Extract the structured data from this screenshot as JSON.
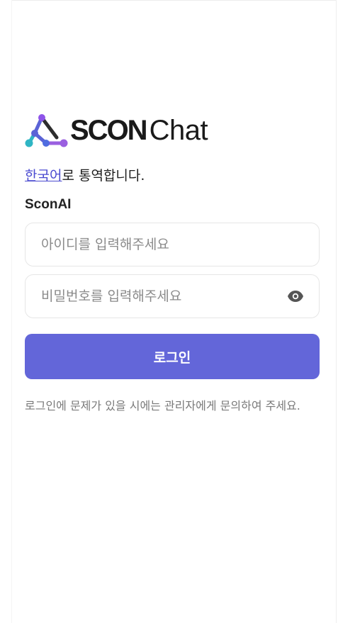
{
  "logo": {
    "bold_text": "SCON",
    "light_text": "Chat",
    "mark_icon": "scon-network-logo-icon"
  },
  "translate": {
    "language_link": "한국어",
    "suffix": "로 통역합니다."
  },
  "organization": "SconAI",
  "form": {
    "id_placeholder": "아이디를 입력해주세요",
    "password_placeholder": "비밀번호를 입력해주세요",
    "password_toggle_icon": "eye-icon",
    "login_label": "로그인"
  },
  "help_text": "로그인에 문제가 있을 시에는 관리자에게 문의하여 주세요.",
  "colors": {
    "accent": "#6366d9",
    "link": "#4a4ad0"
  }
}
